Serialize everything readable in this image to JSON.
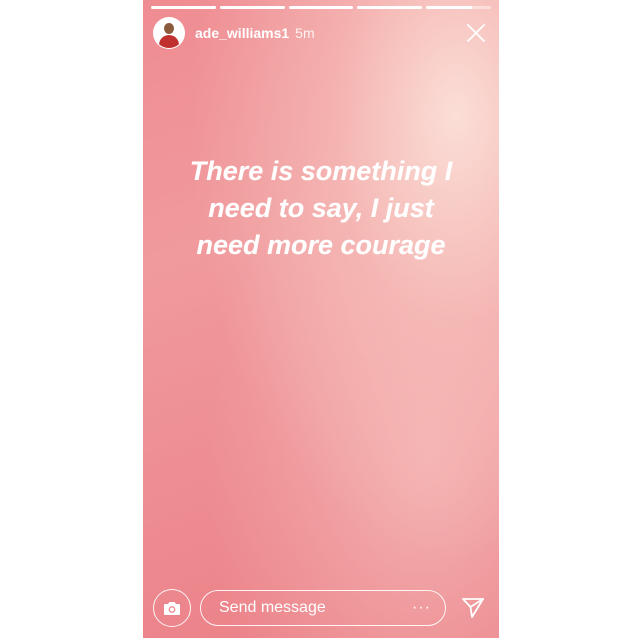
{
  "story": {
    "progress": [
      1,
      1,
      1,
      1,
      0.7
    ],
    "user": {
      "username": "ade_williams1",
      "time": "5m"
    },
    "text_lines": [
      "There is something I",
      "need to say, I just",
      "need more courage"
    ],
    "reply": {
      "placeholder": "Send message",
      "more": "···"
    },
    "icons": {
      "close": "close-icon",
      "camera": "camera-icon",
      "send": "send-icon"
    },
    "colors": {
      "gradient_light": "#fce2da",
      "gradient_main": "#ef8c92",
      "gradient_deep": "#ea7e85",
      "text": "#ffffff"
    }
  }
}
